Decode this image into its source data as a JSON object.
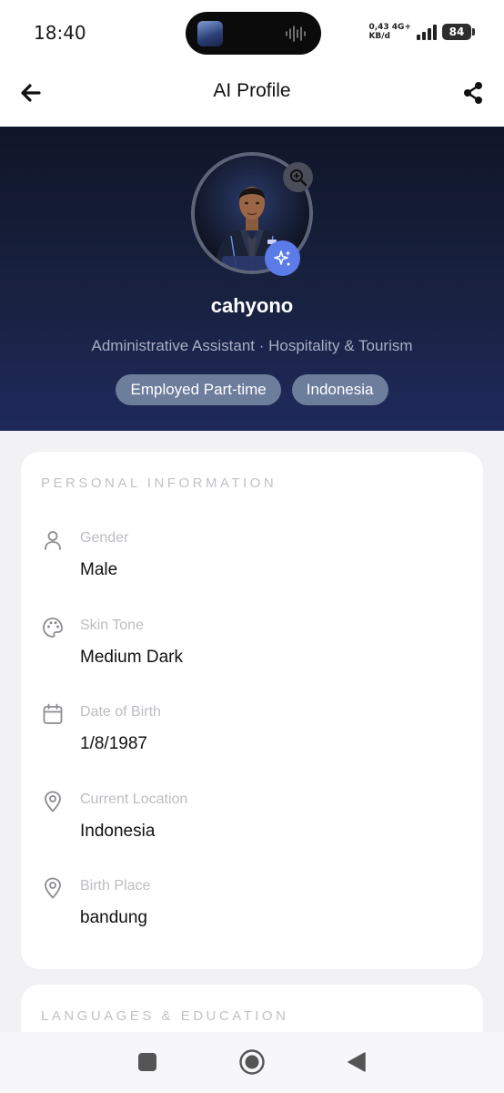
{
  "status_bar": {
    "time": "18:40",
    "net_speed": "0,43",
    "net_unit": "KB/d",
    "net_type": "4G+",
    "battery": "84"
  },
  "header": {
    "title": "AI Profile",
    "back_icon": "arrow-left-icon",
    "share_icon": "share-icon"
  },
  "profile": {
    "name": "cahyono",
    "subtitle": "Administrative Assistant · Hospitality & Tourism",
    "tags": [
      "Employed Part-time",
      "Indonesia"
    ],
    "avatar_icon": "avatar",
    "zoom_icon": "zoom-in-icon",
    "ai_icon": "sparkle-icon"
  },
  "personal": {
    "section_title": "PERSONAL INFORMATION",
    "rows": [
      {
        "icon": "person-icon",
        "label": "Gender",
        "value": "Male"
      },
      {
        "icon": "palette-icon",
        "label": "Skin Tone",
        "value": "Medium Dark"
      },
      {
        "icon": "calendar-icon",
        "label": "Date of Birth",
        "value": "1/8/1987"
      },
      {
        "icon": "location-pin-icon",
        "label": "Current Location",
        "value": "Indonesia"
      },
      {
        "icon": "location-pin-icon",
        "label": "Birth Place",
        "value": "bandung"
      }
    ]
  },
  "languages": {
    "section_title": "LANGUAGES & EDUCATION"
  },
  "colors": {
    "accent": "#5b7be8",
    "hero_top": "#0f1629",
    "hero_bottom": "#1f2a5c",
    "tag_bg": "#6d7e9d"
  }
}
